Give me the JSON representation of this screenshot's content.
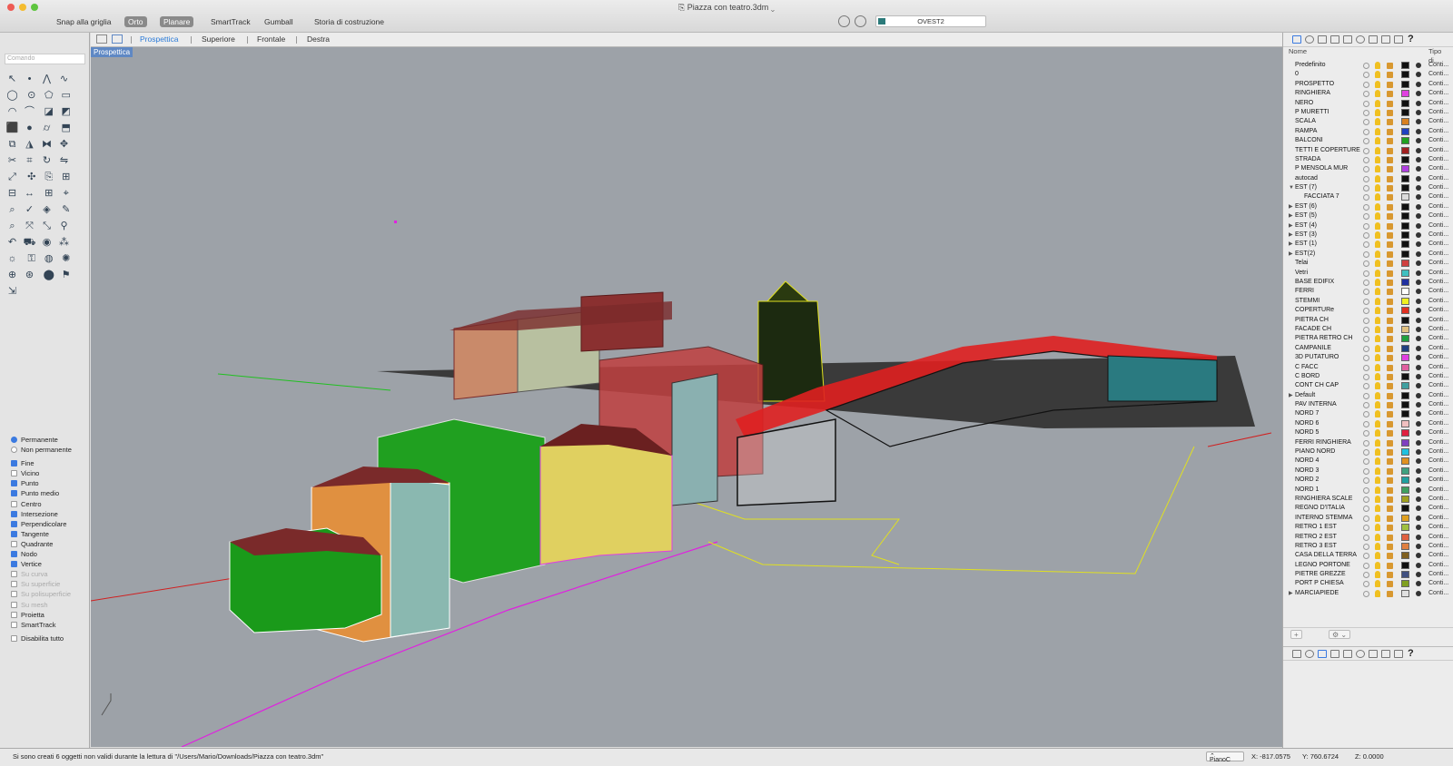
{
  "window": {
    "title": "Piazza con teatro.3dm"
  },
  "toolbar": {
    "snap_grid": "Snap alla griglia",
    "orto": "Orto",
    "planare": "Planare",
    "smarttrack": "SmartTrack",
    "gumball": "Gumball",
    "history": "Storia di costruzione",
    "named_view": "OVEST2"
  },
  "command": {
    "placeholder": "Comando"
  },
  "viewport_tabs": [
    "Prospettica",
    "Superiore",
    "Frontale",
    "Destra"
  ],
  "viewport": {
    "label": "Prospettica"
  },
  "osnap": {
    "permanente": "Permanente",
    "non_permanente": "Non permanente",
    "items": [
      {
        "label": "Fine",
        "checked": true,
        "disabled": false
      },
      {
        "label": "Vicino",
        "checked": false,
        "disabled": false
      },
      {
        "label": "Punto",
        "checked": true,
        "disabled": false
      },
      {
        "label": "Punto medio",
        "checked": true,
        "disabled": false
      },
      {
        "label": "Centro",
        "checked": false,
        "disabled": false
      },
      {
        "label": "Intersezione",
        "checked": true,
        "disabled": false
      },
      {
        "label": "Perpendicolare",
        "checked": true,
        "disabled": false
      },
      {
        "label": "Tangente",
        "checked": true,
        "disabled": false
      },
      {
        "label": "Quadrante",
        "checked": false,
        "disabled": false
      },
      {
        "label": "Nodo",
        "checked": true,
        "disabled": false
      },
      {
        "label": "Vertice",
        "checked": true,
        "disabled": false
      },
      {
        "label": "Su curva",
        "checked": false,
        "disabled": true
      },
      {
        "label": "Su superficie",
        "checked": false,
        "disabled": true
      },
      {
        "label": "Su polisuperficie",
        "checked": false,
        "disabled": true
      },
      {
        "label": "Su mesh",
        "checked": false,
        "disabled": true
      },
      {
        "label": "Proietta",
        "checked": false,
        "disabled": false
      },
      {
        "label": "SmartTrack",
        "checked": false,
        "disabled": false
      }
    ],
    "disable_all": "Disabilita tutto"
  },
  "layers_panel": {
    "col_name": "Nome",
    "col_type": "Tipo di...",
    "type_value": "Conti...",
    "layers": [
      {
        "name": "Predefinito",
        "color": "#111111",
        "indent": 0
      },
      {
        "name": "0",
        "color": "#111111",
        "indent": 0
      },
      {
        "name": "PROSPETTO",
        "color": "#111111",
        "indent": 0
      },
      {
        "name": "RINGHIERA",
        "color": "#e040e0",
        "indent": 0
      },
      {
        "name": "NERO",
        "color": "#111111",
        "indent": 0
      },
      {
        "name": "P MURETTI",
        "color": "#111111",
        "indent": 0
      },
      {
        "name": "SCALA",
        "color": "#d88020",
        "indent": 0
      },
      {
        "name": "RAMPA",
        "color": "#2040c0",
        "indent": 0
      },
      {
        "name": "BALCONI",
        "color": "#20a020",
        "indent": 0
      },
      {
        "name": "TETTI E COPERTURE",
        "color": "#a02020",
        "indent": 0
      },
      {
        "name": "STRADA",
        "color": "#111111",
        "indent": 0
      },
      {
        "name": "P MENSOLA MUR",
        "color": "#b040e0",
        "indent": 0
      },
      {
        "name": "autocad",
        "color": "#111111",
        "indent": 0
      },
      {
        "name": "EST (7)",
        "color": "#111111",
        "indent": 0,
        "expanded": true
      },
      {
        "name": "FACCIATA 7",
        "color": "#dddddd",
        "indent": 1
      },
      {
        "name": "EST (6)",
        "color": "#111111",
        "indent": 0,
        "collapsed": true
      },
      {
        "name": "EST (5)",
        "color": "#111111",
        "indent": 0,
        "collapsed": true
      },
      {
        "name": "EST (4)",
        "color": "#111111",
        "indent": 0,
        "collapsed": true
      },
      {
        "name": "EST (3)",
        "color": "#111111",
        "indent": 0,
        "collapsed": true
      },
      {
        "name": "EST (1)",
        "color": "#111111",
        "indent": 0,
        "collapsed": true
      },
      {
        "name": "EST(2)",
        "color": "#111111",
        "indent": 0,
        "collapsed": true
      },
      {
        "name": "Telai",
        "color": "#d04040",
        "indent": 0
      },
      {
        "name": "Vetri",
        "color": "#40c0c0",
        "indent": 0
      },
      {
        "name": "BASE EDIFIX",
        "color": "#2030a0",
        "indent": 0
      },
      {
        "name": "FERRI",
        "color": "#ffffff",
        "indent": 0
      },
      {
        "name": "STEMMI",
        "color": "#f0f020",
        "indent": 0
      },
      {
        "name": "COPERTURe",
        "color": "#e03020",
        "indent": 0
      },
      {
        "name": "PIETRA CH",
        "color": "#111111",
        "indent": 0
      },
      {
        "name": "FACADE CH",
        "color": "#e0c080",
        "indent": 0
      },
      {
        "name": "PIETRA RETRO CH",
        "color": "#20a040",
        "indent": 0
      },
      {
        "name": "CAMPANILE",
        "color": "#204080",
        "indent": 0
      },
      {
        "name": "3D PUTATURO",
        "color": "#e040e0",
        "indent": 0
      },
      {
        "name": "C FACC",
        "color": "#e060a0",
        "indent": 0
      },
      {
        "name": "C BORD",
        "color": "#111111",
        "indent": 0
      },
      {
        "name": "CONT CH CAP",
        "color": "#40a0a0",
        "indent": 0
      },
      {
        "name": "Default",
        "color": "#111111",
        "indent": 0,
        "collapsed": true
      },
      {
        "name": "PAV INTERNA",
        "color": "#111111",
        "indent": 0
      },
      {
        "name": "NORD 7",
        "color": "#111111",
        "indent": 0
      },
      {
        "name": "NORD 6",
        "color": "#f0c0c0",
        "indent": 0
      },
      {
        "name": "NORD 5",
        "color": "#e02040",
        "indent": 0
      },
      {
        "name": "FERRI RINGHIERA",
        "color": "#8040c0",
        "indent": 0
      },
      {
        "name": "PIANO NORD",
        "color": "#20c0e0",
        "indent": 0
      },
      {
        "name": "NORD 4",
        "color": "#e09020",
        "indent": 0
      },
      {
        "name": "NORD 3",
        "color": "#40a080",
        "indent": 0
      },
      {
        "name": "NORD 2",
        "color": "#20a0a0",
        "indent": 0
      },
      {
        "name": "NORD 1",
        "color": "#40a060",
        "indent": 0
      },
      {
        "name": "RINGHIERA SCALE",
        "color": "#a0a020",
        "indent": 0
      },
      {
        "name": "REGNO D'ITALIA",
        "color": "#111111",
        "indent": 0
      },
      {
        "name": "INTERNO STEMMA",
        "color": "#e0a020",
        "indent": 0
      },
      {
        "name": "RETRO 1 EST",
        "color": "#a0c040",
        "indent": 0
      },
      {
        "name": "RETRO 2 EST",
        "color": "#e06040",
        "indent": 0
      },
      {
        "name": "RETRO 3 EST",
        "color": "#e08040",
        "indent": 0
      },
      {
        "name": "CASA DELLA TERRA",
        "color": "#806020",
        "indent": 0
      },
      {
        "name": "LEGNO PORTONE",
        "color": "#111111",
        "indent": 0
      },
      {
        "name": "PIETRE GREZZE",
        "color": "#405080",
        "indent": 0
      },
      {
        "name": "PORT P CHIESA",
        "color": "#80a020",
        "indent": 0
      },
      {
        "name": "MARCIAPIEDE",
        "color": "#e0e0e0",
        "indent": 0,
        "collapsed": true
      }
    ],
    "add_button": "+",
    "gear_button": "⚙ ⌄"
  },
  "status": {
    "message": "Si sono creati 6 oggetti non validi durante la lettura di \"/Users/Mario/Downloads/Piazza con teatro.3dm\"",
    "plane": "PianoC",
    "x": "X: -817.0575",
    "y": "Y: 760.6724",
    "z": "Z: 0.0000"
  }
}
